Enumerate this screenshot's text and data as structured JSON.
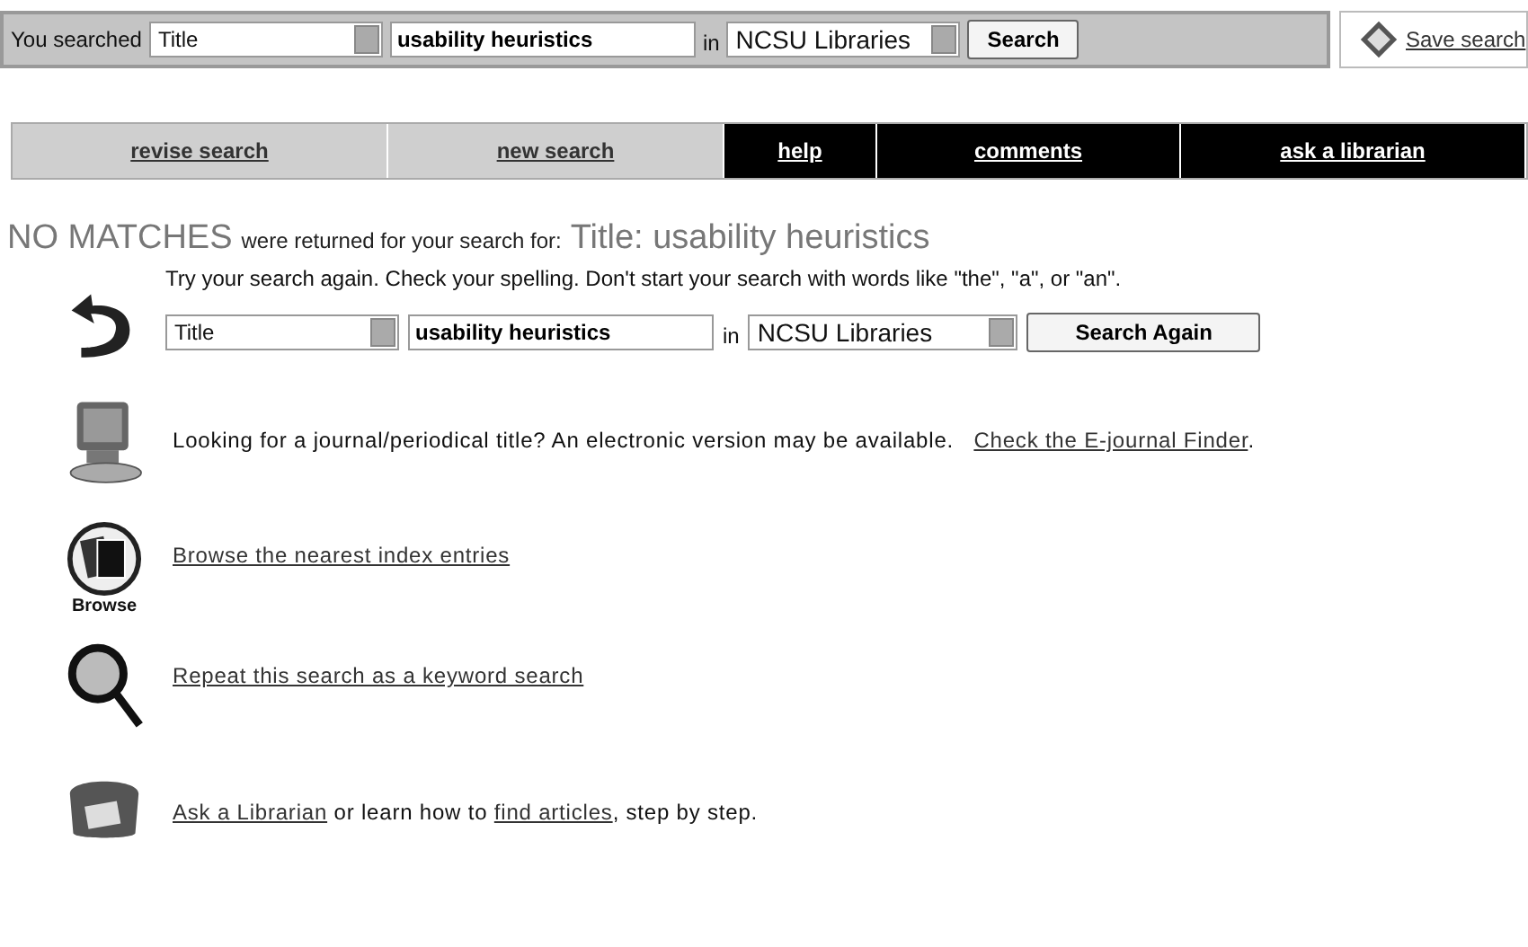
{
  "search_bar": {
    "label": "You searched",
    "field": "Title",
    "query": "usability heuristics",
    "in_label": "in",
    "scope": "NCSU Libraries",
    "button": "Search",
    "save": "Save search"
  },
  "nav": [
    {
      "label": "revise search",
      "dark": false
    },
    {
      "label": "new search",
      "dark": false
    },
    {
      "label": "help",
      "dark": true
    },
    {
      "label": "comments",
      "dark": true
    },
    {
      "label": "ask a librarian",
      "dark": true
    }
  ],
  "heading": {
    "lead": "NO MATCHES",
    "middle": "were returned for your search for:",
    "query": "Title: usability heuristics"
  },
  "retry": {
    "hint": "Try your search again. Check your spelling. Don't start your search with words like \"the\", \"a\", or \"an\".",
    "field": "Title",
    "query": "usability heuristics",
    "in_label": "in",
    "scope": "NCSU Libraries",
    "button": "Search Again"
  },
  "options": [
    {
      "kind": "monitor",
      "parts": [
        {
          "text": "Looking for a journal/periodical title? An electronic version may be available.   ",
          "link": false
        },
        {
          "text": "Check the E-journal Finder",
          "link": true
        },
        {
          "text": ".",
          "link": false
        }
      ]
    },
    {
      "kind": "browse",
      "caption": "Browse",
      "parts": [
        {
          "text": "Browse the nearest index entries",
          "link": true
        }
      ]
    },
    {
      "kind": "magnifier",
      "parts": [
        {
          "text": "Repeat this search as a keyword search",
          "link": true
        }
      ]
    },
    {
      "kind": "phone",
      "parts": [
        {
          "text": "Ask a Librarian",
          "link": true
        },
        {
          "text": " or learn how to ",
          "link": false
        },
        {
          "text": "find articles",
          "link": true
        },
        {
          "text": ", step by step.",
          "link": false
        }
      ]
    }
  ]
}
